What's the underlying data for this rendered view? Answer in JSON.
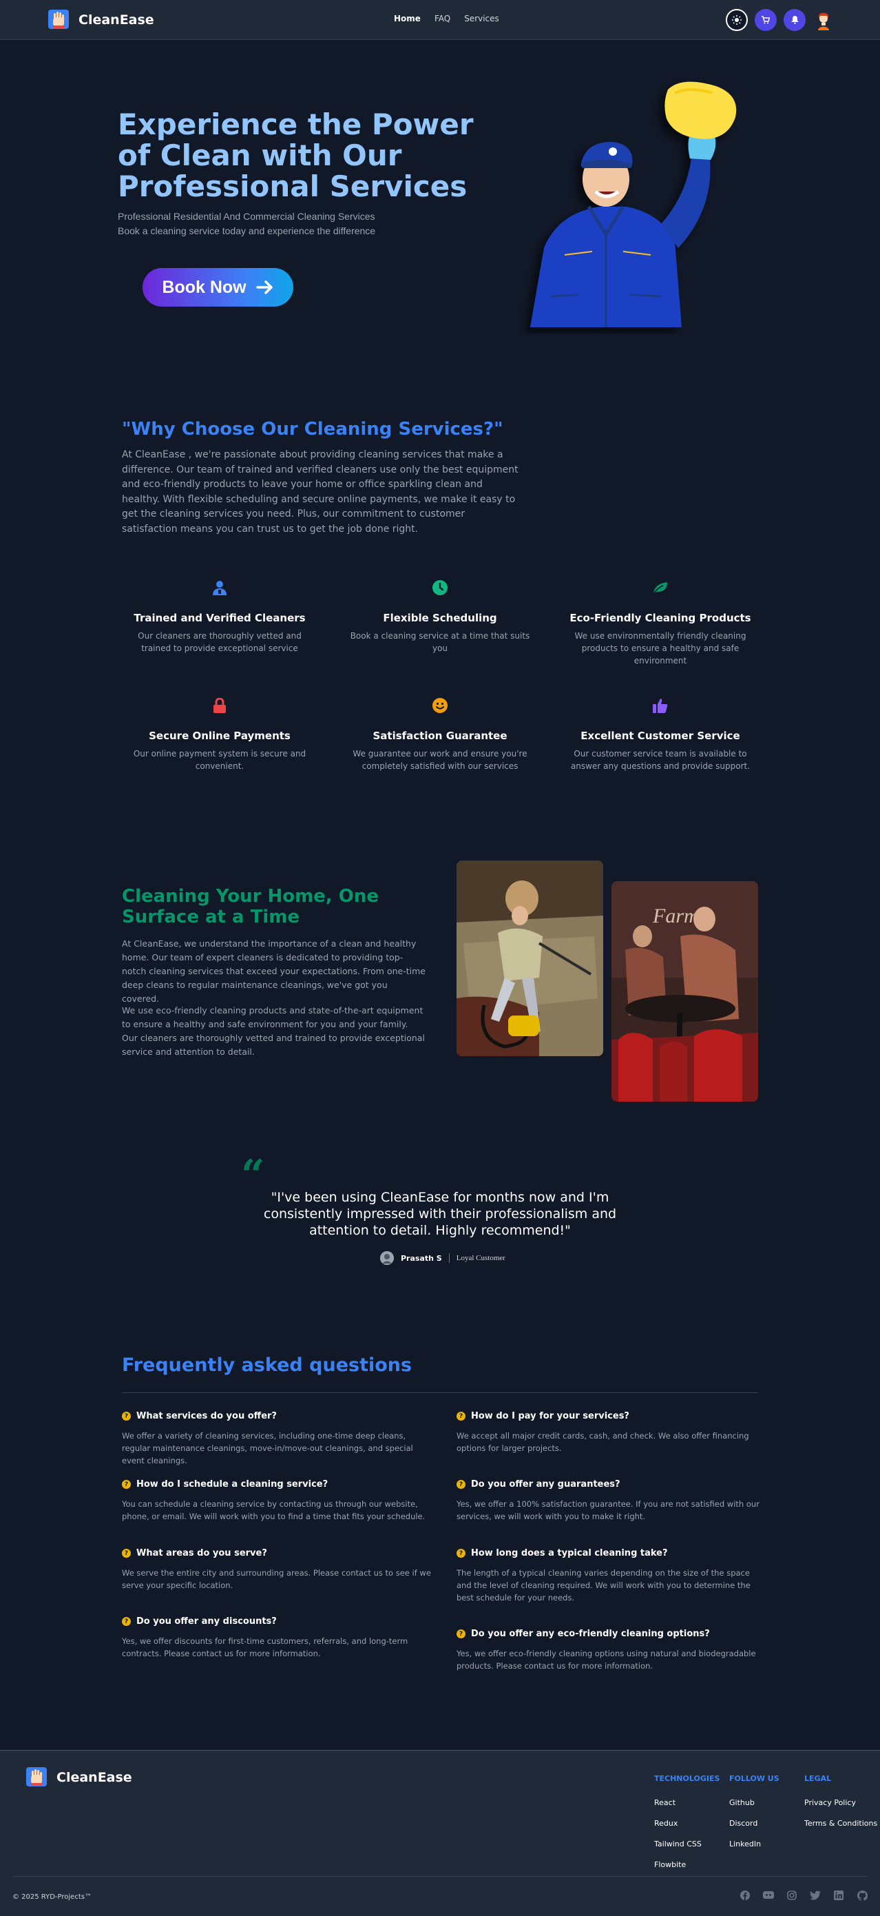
{
  "nav": {
    "brand": "CleanEase",
    "links": [
      {
        "label": "Home",
        "active": true
      },
      {
        "label": "FAQ",
        "active": false
      },
      {
        "label": "Services",
        "active": false
      }
    ],
    "icons": [
      "theme-toggle-icon",
      "cart-icon",
      "notification-bell-icon",
      "user-avatar"
    ]
  },
  "hero": {
    "title": "Experience the Power of Clean with Our Professional Services",
    "subtitle_1": "Professional Residential And Commercial Cleaning Services",
    "subtitle_2": "Book a cleaning service today and experience the difference",
    "cta_label": "Book Now"
  },
  "why": {
    "title": "\"Why Choose Our Cleaning Services?\"",
    "text": "At CleanEase , we're passionate about providing cleaning services that make a difference. Our team of trained and verified cleaners use only the best equipment and eco-friendly products to leave your home or office sparkling clean and healthy. With flexible scheduling and secure online payments, we make it easy to get the cleaning services you need. Plus, our commitment to customer satisfaction means you can trust us to get the job done right.",
    "features": [
      {
        "icon": "user-badge-icon",
        "color": "#3b82f6",
        "title": "Trained and Verified Cleaners",
        "desc": "Our cleaners are thoroughly vetted and trained to provide exceptional service"
      },
      {
        "icon": "clock-icon",
        "color": "#10b981",
        "title": "Flexible Scheduling",
        "desc": "Book a cleaning service at a time that suits you"
      },
      {
        "icon": "leaf-icon",
        "color": "#059669",
        "title": "Eco-Friendly Cleaning Products",
        "desc": "We use environmentally friendly cleaning products to ensure a healthy and safe environment"
      },
      {
        "icon": "lock-icon",
        "color": "#ef4444",
        "title": "Secure Online Payments",
        "desc": "Our online payment system is secure and convenient."
      },
      {
        "icon": "smile-icon",
        "color": "#f59e0b",
        "title": "Satisfaction Guarantee",
        "desc": "We guarantee our work and ensure you're completely satisfied with our services"
      },
      {
        "icon": "thumbs-up-icon",
        "color": "#8b5cf6",
        "title": "Excellent Customer Service",
        "desc": "Our customer service team is available to answer any questions and provide support."
      }
    ]
  },
  "home_section": {
    "title": "Cleaning Your Home, One Surface at a Time",
    "p1": "At CleanEase, we understand the importance of a clean and healthy home. Our team of expert cleaners is dedicated to providing top-notch cleaning services that exceed your expectations. From one-time deep cleans to regular maintenance cleanings, we've got you covered.",
    "p2": "We use eco-friendly cleaning products and state-of-the-art equipment to ensure a healthy and safe environment for you and your family. Our cleaners are thoroughly vetted and trained to provide exceptional service and attention to detail."
  },
  "testimonial": {
    "quote_mark": "“",
    "text": "\"I've been using CleanEase for months now and I'm consistently impressed with their professionalism and attention to detail. Highly recommend!\"",
    "author": "Prasath S",
    "role": "Loyal Customer"
  },
  "faq": {
    "title": "Frequently asked questions",
    "left": [
      {
        "q": "What services do you offer?",
        "a": "We offer a variety of cleaning services, including one-time deep cleans, regular maintenance cleanings, move-in/move-out cleanings, and special event cleanings."
      },
      {
        "q": "How do I schedule a cleaning service?",
        "a": "You can schedule a cleaning service by contacting us through our website, phone, or email. We will work with you to find a time that fits your schedule."
      },
      {
        "q": "What areas do you serve?",
        "a": "We serve the entire city and surrounding areas. Please contact us to see if we serve your specific location."
      },
      {
        "q": "Do you offer any discounts?",
        "a": "Yes, we offer discounts for first-time customers, referrals, and long-term contracts. Please contact us for more information."
      }
    ],
    "right": [
      {
        "q": "How do I pay for your services?",
        "a": "We accept all major credit cards, cash, and check. We also offer financing options for larger projects."
      },
      {
        "q": "Do you offer any guarantees?",
        "a": "Yes, we offer a 100% satisfaction guarantee. If you are not satisfied with our services, we will work with you to make it right."
      },
      {
        "q": "How long does a typical cleaning take?",
        "a": "The length of a typical cleaning varies depending on the size of the space and the level of cleaning required. We will work with you to determine the best schedule for your needs."
      },
      {
        "q": "Do you offer any eco-friendly cleaning options?",
        "a": "Yes, we offer eco-friendly cleaning options using natural and biodegradable products. Please contact us for more information."
      }
    ]
  },
  "footer": {
    "brand": "CleanEase",
    "columns": [
      {
        "heading": "TECHNOLOGIES",
        "links": [
          "React",
          "Redux",
          "Tailwind CSS",
          "Flowbite"
        ]
      },
      {
        "heading": "FOLLOW US",
        "links": [
          "Github",
          "Discord",
          "LinkedIn"
        ]
      },
      {
        "heading": "LEGAL",
        "links": [
          "Privacy Policy",
          "Terms & Conditions"
        ]
      }
    ],
    "copyright": "© 2025 RYD-Projects™",
    "socials": [
      "facebook-icon",
      "discord-icon",
      "instagram-icon",
      "twitter-icon",
      "linkedin-icon",
      "github-icon"
    ]
  }
}
